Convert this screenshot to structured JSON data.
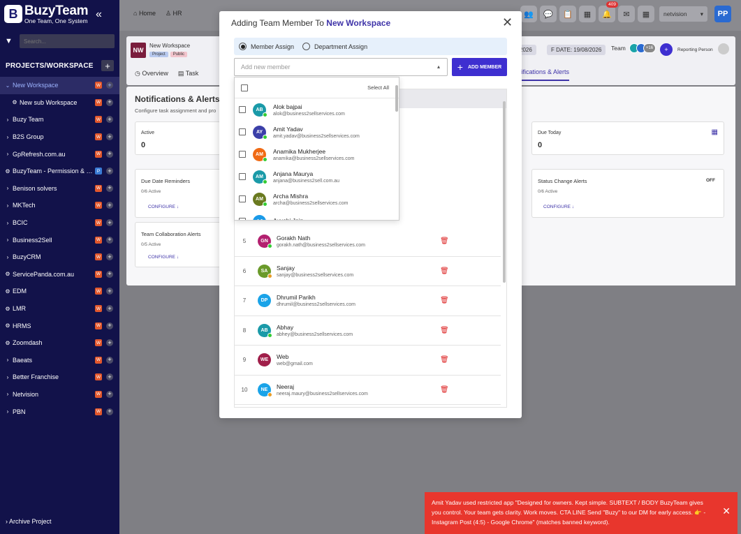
{
  "brand": {
    "name": "BuzyTeam",
    "tagline": "One Team, One System",
    "mark": "B"
  },
  "sidebar": {
    "search_placeholder": "Search...",
    "section_title": "PROJECTS/WORKSPACE",
    "items": [
      {
        "label": "New Workspace",
        "badge": "W",
        "active": true,
        "icon": "chevron-down"
      },
      {
        "label": "New sub Workspace",
        "badge": "W",
        "sub": true,
        "icon": "workspace"
      },
      {
        "label": "Buzy Team",
        "badge": "W",
        "icon": "chevron-right"
      },
      {
        "label": "B2S Group",
        "badge": "W",
        "icon": "chevron-right"
      },
      {
        "label": "GpRefresh.com.au",
        "badge": "W",
        "icon": "chevron-right"
      },
      {
        "label": "BuzyTeam - Permission & S...",
        "badge": "P",
        "icon": "workspace"
      },
      {
        "label": "Benison solvers",
        "badge": "W",
        "icon": "chevron-right"
      },
      {
        "label": "MKTech",
        "badge": "W",
        "icon": "chevron-right"
      },
      {
        "label": "BCIC",
        "badge": "W",
        "icon": "chevron-right"
      },
      {
        "label": "Business2Sell",
        "badge": "W",
        "icon": "chevron-right"
      },
      {
        "label": "BuzyCRM",
        "badge": "W",
        "icon": "chevron-right"
      },
      {
        "label": "ServicePanda.com.au",
        "badge": "W",
        "icon": "workspace"
      },
      {
        "label": "EDM",
        "badge": "W",
        "icon": "workspace"
      },
      {
        "label": "LMR",
        "badge": "W",
        "icon": "workspace"
      },
      {
        "label": "HRMS",
        "badge": "W",
        "icon": "workspace"
      },
      {
        "label": "Zoomdash",
        "badge": "W",
        "icon": "workspace"
      },
      {
        "label": "Baeats",
        "badge": "W",
        "icon": "chevron-right"
      },
      {
        "label": "Better Franchise",
        "badge": "W",
        "icon": "chevron-right"
      },
      {
        "label": "Netvision",
        "badge": "W",
        "icon": "chevron-right"
      },
      {
        "label": "PBN",
        "badge": "W",
        "icon": "chevron-right"
      }
    ],
    "archive_label": "Archive Project"
  },
  "topbar": {
    "nav": [
      {
        "label": "Home",
        "icon": "home-icon"
      },
      {
        "label": "HR",
        "icon": "users-icon"
      }
    ],
    "notification_count": "409",
    "workspace_select": "netvision",
    "user_initials": "PP"
  },
  "project": {
    "initials": "NW",
    "name": "New Workspace",
    "tags": [
      "Project",
      "Public"
    ],
    "start_date_fragment": "2026",
    "end_date": "F DATE: 19/08/2026",
    "team_label": "Team",
    "team_extra": "+16",
    "reporting_label": "Reporting Person",
    "tabs": [
      "Overview",
      "Task"
    ],
    "active_tab": "tifications & Alerts"
  },
  "content": {
    "title": "Notifications & Alerts",
    "desc": "Configure task assignment and pro",
    "active": {
      "label": "Active",
      "value": "0"
    },
    "due_today": {
      "label": "Due Today",
      "value": "0"
    },
    "due_date": {
      "label": "Due Date Reminders",
      "sub": "0/6 Active",
      "btn": "CONFIGURE"
    },
    "status": {
      "label": "Status Change Alerts",
      "sub": "0/6 Active",
      "btn": "CONFIGURE",
      "toggle": "OFF"
    },
    "team_collab": {
      "label": "Team Collaboration Alerts",
      "sub": "0/5 Active",
      "btn": "CONFIGURE"
    }
  },
  "modal": {
    "title_prefix": "Adding Team Member To ",
    "title_workspace": "New Workspace",
    "radio_member": "Member Assign",
    "radio_department": "Department Assign",
    "input_placeholder": "Add new member",
    "add_button": "ADD MEMBER",
    "rows": [
      {
        "num": "5",
        "initials": "GN",
        "name": "Gorakh Nath",
        "email": "gorakh.nath@business2sellservices.com",
        "color": "#b3206f",
        "status": "online"
      },
      {
        "num": "6",
        "initials": "SA",
        "name": "Sanjay",
        "email": "sanjay@business2sellservices.com",
        "color": "#6a9a2a",
        "status": "away"
      },
      {
        "num": "7",
        "initials": "DP",
        "name": "Dhrumil Parikh",
        "email": "dhrumil@business2sellservices.com",
        "color": "#1aa3e8",
        "status": "none"
      },
      {
        "num": "8",
        "initials": "AB",
        "name": "Abhay",
        "email": "abhey@business2sellservices.com",
        "color": "#1a9aa8",
        "status": "online"
      },
      {
        "num": "9",
        "initials": "WE",
        "name": "Web",
        "email": "web@gmail.com",
        "color": "#a01f4a",
        "status": "none"
      },
      {
        "num": "10",
        "initials": "NE",
        "name": "Neeraj",
        "email": "neeraj.maury@business2sellservices.com",
        "color": "#1aa3e8",
        "status": "away"
      }
    ]
  },
  "dropdown": {
    "select_all": "Select All",
    "items": [
      {
        "initials": "AB",
        "name": "Alok bajpai",
        "email": "alok@business2sellservices.com",
        "color": "#1a9aa8"
      },
      {
        "initials": "AY",
        "name": "Amit Yadav",
        "email": "amit.yadav@business2sellservices.com",
        "color": "#3b3fa8"
      },
      {
        "initials": "AM",
        "name": "Anamika Mukherjee",
        "email": "anamika@business2sellservices.com",
        "color": "#f06a14"
      },
      {
        "initials": "AM",
        "name": "Anjana Maurya",
        "email": "anjana@business2sell.com.au",
        "color": "#1a9aa8"
      },
      {
        "initials": "AM",
        "name": "Archa Mishra",
        "email": "archa@business2sellservices.com",
        "color": "#6a7a20"
      },
      {
        "initials": "AJ",
        "name": "Ayushi Jain",
        "email": "",
        "color": "#1a9ae8"
      }
    ]
  },
  "toast": {
    "message": "Amit Yadav used restricted app \"Designed for owners. Kept simple. SUBTEXT / BODY BuzyTeam gives you control. Your team gets clarity. Work moves. CTA LINE Send \"Buzy\" to our DM for early access. 👉 - Instagram Post (4:5) - Google Chrome\" (matches banned keyword)."
  }
}
